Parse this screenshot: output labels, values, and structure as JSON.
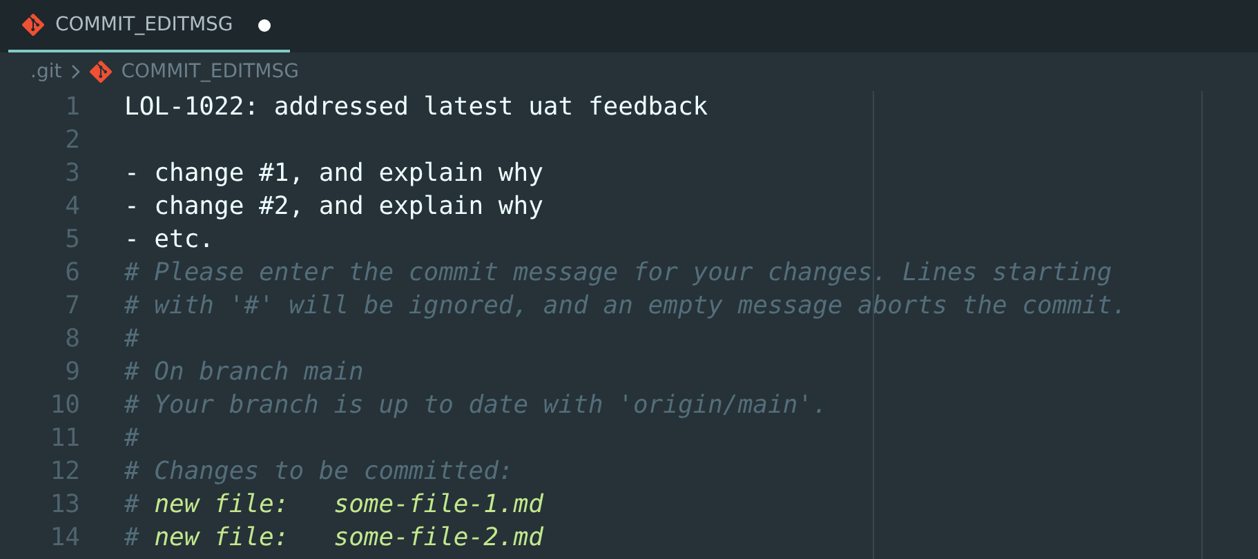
{
  "tab": {
    "label": "COMMIT_EDITMSG",
    "selected": true,
    "dirty": true
  },
  "breadcrumb": [
    {
      "label": ".git",
      "kind": "folder"
    },
    {
      "label": "COMMIT_EDITMSG",
      "kind": "file"
    }
  ],
  "lines": [
    {
      "number": "1",
      "kind": "text",
      "text": "LOL-1022: addressed latest uat feedback"
    },
    {
      "number": "2",
      "kind": "empty"
    },
    {
      "number": "3",
      "kind": "text",
      "text": "- change #1, and explain why"
    },
    {
      "number": "4",
      "kind": "text",
      "text": "- change #2, and explain why"
    },
    {
      "number": "5",
      "kind": "text",
      "text": "- etc."
    },
    {
      "number": "6",
      "kind": "comment",
      "text": "# Please enter the commit message for your changes. Lines starting"
    },
    {
      "number": "7",
      "kind": "comment",
      "text": "# with '#' will be ignored, and an empty message aborts the commit."
    },
    {
      "number": "8",
      "kind": "comment",
      "text": "#"
    },
    {
      "number": "9",
      "kind": "comment",
      "text": "# On branch main"
    },
    {
      "number": "10",
      "kind": "comment",
      "text": "# Your branch is up to date with 'origin/main'."
    },
    {
      "number": "11",
      "kind": "comment",
      "text": "#"
    },
    {
      "number": "12",
      "kind": "comment",
      "text": "# Changes to be committed:"
    },
    {
      "number": "13",
      "kind": "change",
      "marker": "#",
      "text": "new file:   some-file-1.md"
    },
    {
      "number": "14",
      "kind": "change",
      "marker": "#",
      "text": "new file:   some-file-2.md"
    }
  ]
}
